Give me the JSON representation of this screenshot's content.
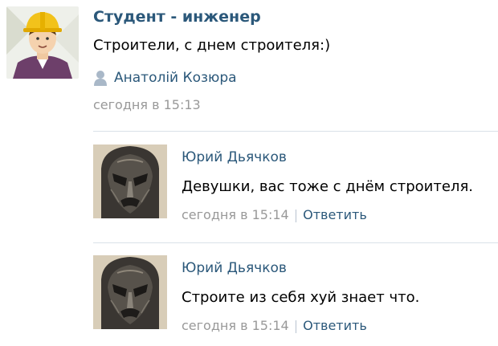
{
  "post": {
    "title": "Студент - инженер",
    "text": "Строители, с днем строителя:)",
    "author": "Анатолій Козюра",
    "time": "сегодня в 15:13",
    "avatar_icon": "construction-worker-avatar",
    "author_icon": "user-icon"
  },
  "comments": [
    {
      "author": "Юрий Дьячков",
      "text": "Девушки, вас тоже с днём строителя.",
      "time": "сегодня в 15:14",
      "separator": "|",
      "reply_label": "Ответить",
      "avatar_icon": "mask-avatar"
    },
    {
      "author": "Юрий Дьячков",
      "text": "Строите из себя хуй знает что.",
      "time": "сегодня в 15:14",
      "separator": "|",
      "reply_label": "Ответить",
      "avatar_icon": "mask-avatar"
    }
  ],
  "colors": {
    "link": "#2b587a",
    "meta": "#999999",
    "divider": "#dae1e8"
  }
}
